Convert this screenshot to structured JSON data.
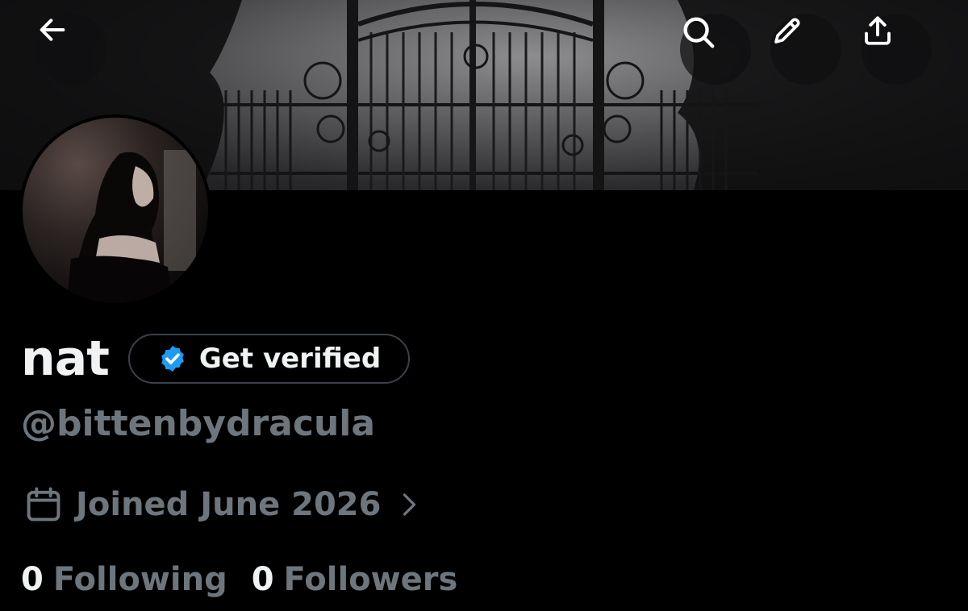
{
  "header": {
    "back_icon": "arrow-left-icon",
    "search_icon": "search-icon",
    "edit_icon": "pencil-icon",
    "share_icon": "share-upload-icon"
  },
  "profile": {
    "display_name": "nat",
    "verify_label": "Get verified",
    "verify_icon": "verified-badge-icon",
    "verify_color": "#1d9bf0",
    "handle": "@bittenbydracula",
    "joined_icon": "calendar-icon",
    "joined_text": "Joined June 2026",
    "chevron_icon": "chevron-right-icon",
    "following_count": "0",
    "following_label": "Following",
    "followers_count": "0",
    "followers_label": "Followers"
  },
  "colors": {
    "background": "#000000",
    "primary_text": "#eff3f4",
    "secondary_text": "#6e767d"
  }
}
